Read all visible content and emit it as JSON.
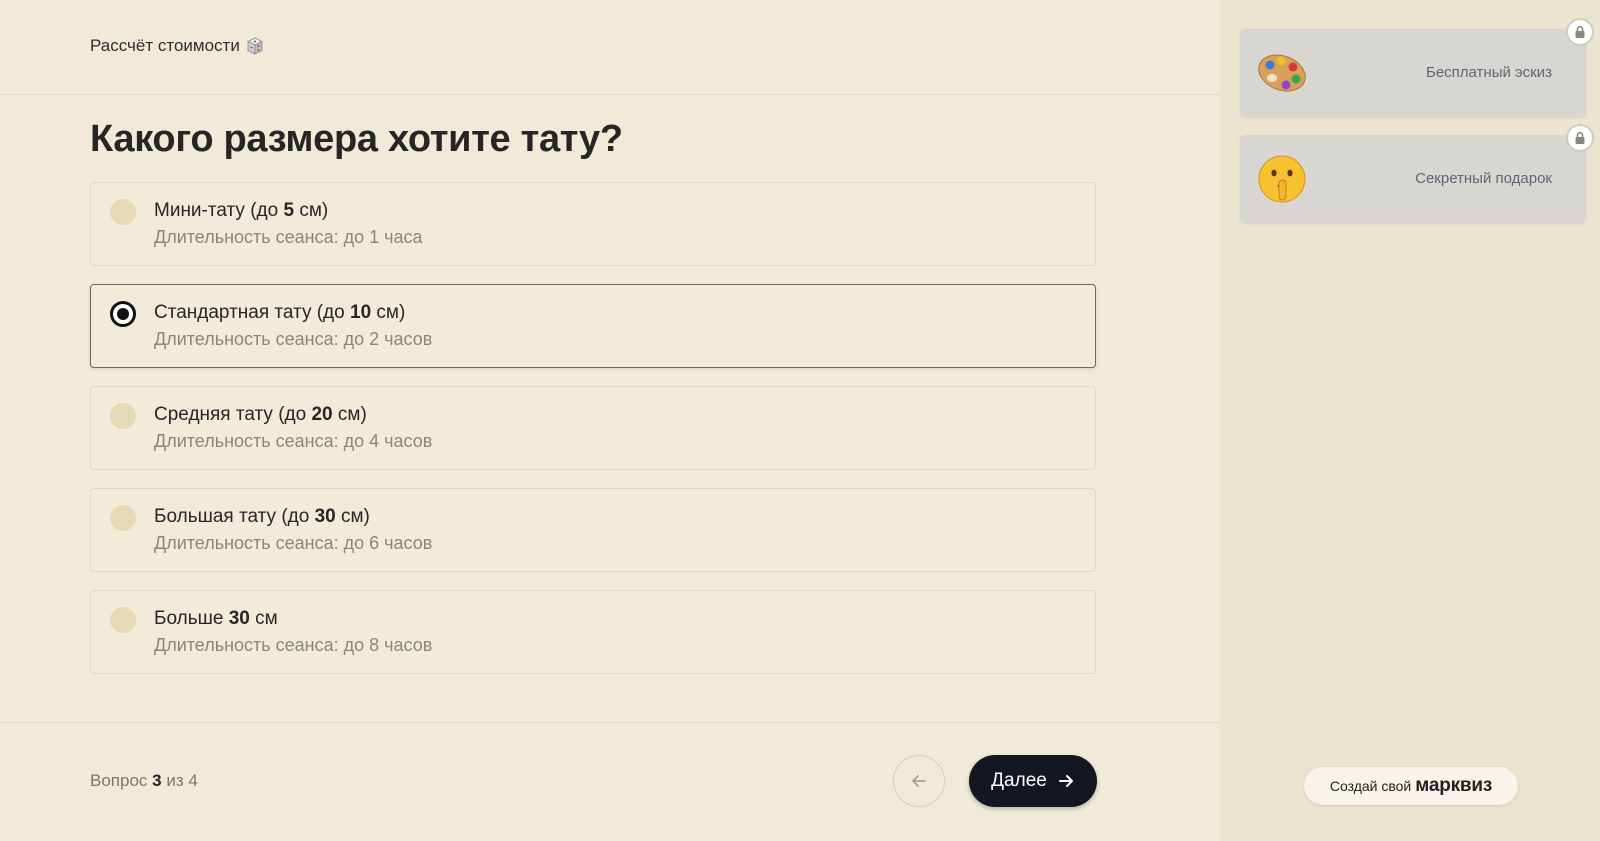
{
  "header": {
    "title": "Рассчёт стоимости",
    "icon": "dice-icon"
  },
  "question": "Какого размера хотите тату?",
  "options": [
    {
      "title_pre": "Мини-тату (до ",
      "title_bold": "5",
      "title_post": " см)",
      "desc": "Длительность сеанса: до 1 часа",
      "selected": false
    },
    {
      "title_pre": "Стандартная тату (до ",
      "title_bold": "10",
      "title_post": " см)",
      "desc": "Длительность сеанса: до 2 часов",
      "selected": true
    },
    {
      "title_pre": "Средняя тату (до ",
      "title_bold": "20",
      "title_post": " см)",
      "desc": "Длительность сеанса: до 4 часов",
      "selected": false
    },
    {
      "title_pre": "Большая тату (до ",
      "title_bold": "30",
      "title_post": " см)",
      "desc": "Длительность сеанса: до 6 часов",
      "selected": false
    },
    {
      "title_pre": "Больше ",
      "title_bold": "30",
      "title_post": " см",
      "desc": "Длительность сеанса: до 8 часов",
      "selected": false
    }
  ],
  "footer": {
    "progress_pre": "Вопрос",
    "progress_current": "3",
    "progress_mid": "из",
    "progress_total": "4",
    "back_icon": "arrow-left-icon",
    "next_label": "Далее",
    "next_icon": "arrow-right-icon"
  },
  "sidebar": {
    "cards": [
      {
        "label": "Бесплатный эскиз",
        "icon": "palette-icon",
        "locked": true
      },
      {
        "label": "Секретный подарок",
        "icon": "shushing-face-icon",
        "locked": true
      }
    ],
    "brand_prefix": "Создай свой",
    "brand_name": "марквиз"
  },
  "colors": {
    "background": "#f1ead8",
    "sidebar": "#ebe4cf",
    "primary_button": "#121722",
    "radio_idle": "#e5dab3"
  }
}
